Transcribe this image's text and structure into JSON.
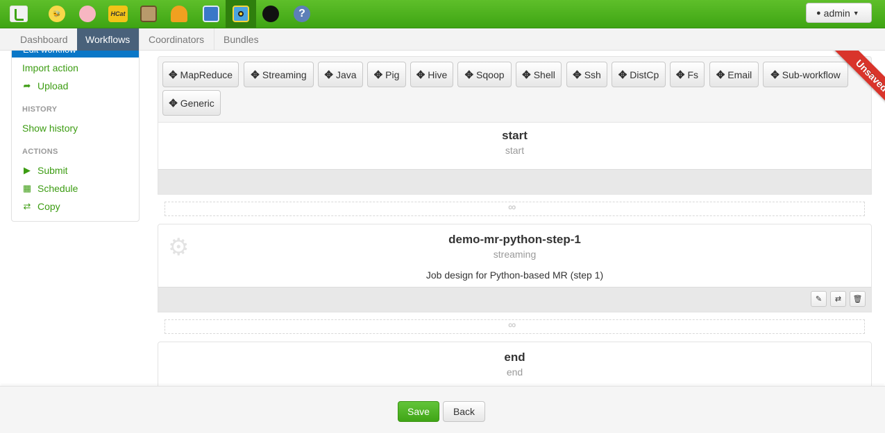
{
  "header": {
    "apps": [
      {
        "name": "hive-icon",
        "label": ""
      },
      {
        "name": "pig-icon",
        "label": ""
      },
      {
        "name": "hcat-icon",
        "label": "HCat"
      },
      {
        "name": "filebrowser-icon",
        "label": ""
      },
      {
        "name": "jobdesigner-icon",
        "label": ""
      },
      {
        "name": "jobbrowser-icon",
        "label": ""
      },
      {
        "name": "oozie-icon",
        "label": ""
      },
      {
        "name": "useradmin-icon",
        "label": ""
      },
      {
        "name": "help-icon",
        "label": "?"
      }
    ],
    "user_label": "admin"
  },
  "tabs": [
    "Dashboard",
    "Workflows",
    "Coordinators",
    "Bundles"
  ],
  "sidebar": {
    "cut_label": "Edit workflow",
    "import_action": "Import action",
    "upload": "Upload",
    "history_heading": "HISTORY",
    "show_history": "Show history",
    "actions_heading": "ACTIONS",
    "submit": "Submit",
    "schedule": "Schedule",
    "copy": "Copy"
  },
  "toolbox": {
    "buttons": [
      "MapReduce",
      "Streaming",
      "Java",
      "Pig",
      "Hive",
      "Sqoop",
      "Shell",
      "Ssh",
      "DistCp",
      "Fs",
      "Email",
      "Sub-workflow",
      "Generic"
    ]
  },
  "ribbon": "Unsaved",
  "nodes": {
    "start": {
      "title": "start",
      "type": "start"
    },
    "action": {
      "title": "demo-mr-python-step-1",
      "type": "streaming",
      "description": "Job design for Python-based MR (step 1)"
    },
    "end": {
      "title": "end",
      "type": "end"
    }
  },
  "footer": {
    "save": "Save",
    "back": "Back"
  },
  "colors": {
    "brand_green": "#3ea413",
    "tab_active": "#49617a",
    "link_green": "#3c9c12",
    "ribbon_red": "#d9342b"
  }
}
